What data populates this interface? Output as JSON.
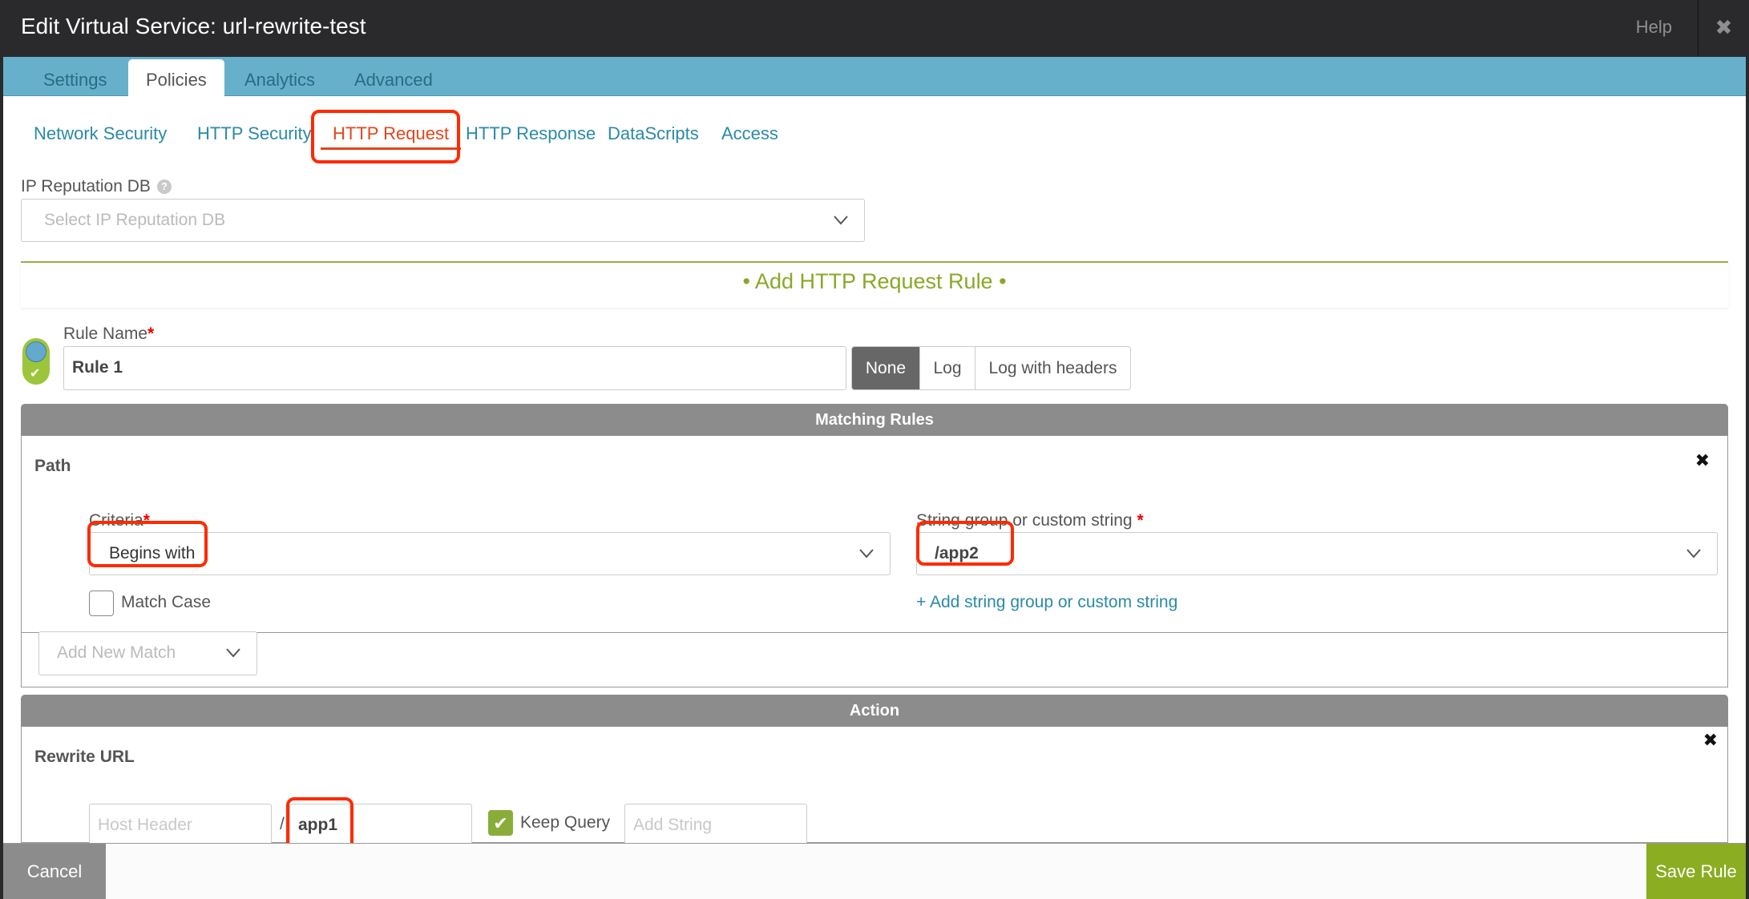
{
  "window": {
    "title": "Edit Virtual Service: url-rewrite-test",
    "help_label": "Help",
    "close_icon": "✖"
  },
  "main_tabs": [
    {
      "label": "Settings",
      "active": false
    },
    {
      "label": "Policies",
      "active": true
    },
    {
      "label": "Analytics",
      "active": false
    },
    {
      "label": "Advanced",
      "active": false
    }
  ],
  "sub_tabs": [
    {
      "label": "Network Security",
      "active": false
    },
    {
      "label": "HTTP Security",
      "active": false
    },
    {
      "label": "HTTP Request",
      "active": true
    },
    {
      "label": "HTTP Response",
      "active": false
    },
    {
      "label": "DataScripts",
      "active": false
    },
    {
      "label": "Access",
      "active": false
    }
  ],
  "ip_reputation": {
    "label": "IP Reputation DB",
    "help_icon": "?",
    "placeholder": "Select IP Reputation DB"
  },
  "rule_header": "• Add HTTP Request Rule •",
  "rule": {
    "enabled": true,
    "check_icon": "✔",
    "name_label": "Rule Name",
    "required_mark": "*",
    "name_value": "Rule 1",
    "logging_options": [
      {
        "label": "None",
        "active": true
      },
      {
        "label": "Log",
        "active": false
      },
      {
        "label": "Log with headers",
        "active": false
      }
    ]
  },
  "matching_rules": {
    "header": "Matching Rules",
    "path": {
      "title": "Path",
      "remove_icon": "✖",
      "criteria_label": "Criteria",
      "criteria_value": "Begins with",
      "match_case_label": "Match Case",
      "match_case_checked": false,
      "string_label": "String group or custom string",
      "string_value": "/app2",
      "add_string_link": "+ Add string group or custom string"
    },
    "add_new_match_placeholder": "Add New Match"
  },
  "action": {
    "header": "Action",
    "rewrite_url": {
      "title": "Rewrite URL",
      "remove_icon": "✖",
      "host_header_placeholder": "Host Header",
      "separator": "/",
      "path_value": "app1",
      "keep_query_label": "Keep Query",
      "keep_query_checked": true,
      "check_icon": "✔",
      "add_string_placeholder": "Add String"
    }
  },
  "footer": {
    "cancel_label": "Cancel",
    "save_label": "Save Rule"
  },
  "colors": {
    "titlebar": "#2a2a2c",
    "tabbar": "#67b0cc",
    "active_subtab": "#e2461b",
    "link": "#2b8aa6",
    "accent_green": "#8aad22",
    "section_header": "#8c8c8c",
    "highlight_annotation": "#ff2a00"
  }
}
